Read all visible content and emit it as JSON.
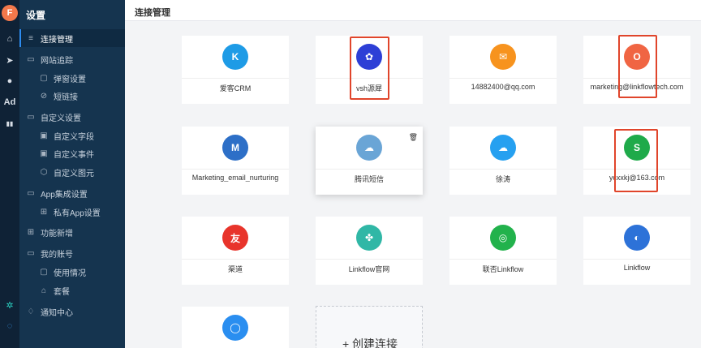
{
  "app": {
    "logo_letter": "F",
    "section_title": "设置"
  },
  "rail": {
    "items": [
      {
        "icon": "home-icon",
        "glyph": "⌂"
      },
      {
        "icon": "send-icon",
        "glyph": "➤"
      },
      {
        "icon": "user-icon",
        "glyph": "●"
      },
      {
        "icon": "ad-icon",
        "glyph": "Ad"
      },
      {
        "icon": "bar-chart-icon",
        "glyph": "▮▮"
      }
    ],
    "bottom": [
      {
        "icon": "gear-icon",
        "glyph": "✲"
      },
      {
        "icon": "chat-icon",
        "glyph": "◌"
      }
    ]
  },
  "sidebar": {
    "items": [
      {
        "label": "连接管理",
        "glyph": "≡",
        "level": 1,
        "active": true
      },
      {
        "label": "网站追踪",
        "glyph": "▭",
        "level": 1
      },
      {
        "label": "弹窗设置",
        "glyph": "▢",
        "level": 2
      },
      {
        "label": "短链接",
        "glyph": "⊘",
        "level": 2
      },
      {
        "label": "自定义设置",
        "glyph": "▭",
        "level": 1
      },
      {
        "label": "自定义字段",
        "glyph": "▣",
        "level": 2
      },
      {
        "label": "自定义事件",
        "glyph": "▣",
        "level": 2
      },
      {
        "label": "自定义图元",
        "glyph": "⬡",
        "level": 2
      },
      {
        "label": "App集成设置",
        "glyph": "▭",
        "level": 1
      },
      {
        "label": "私有App设置",
        "glyph": "⊞",
        "level": 2
      },
      {
        "label": "功能新增",
        "glyph": "⊞",
        "level": 1
      },
      {
        "label": "我的账号",
        "glyph": "▭",
        "level": 1
      },
      {
        "label": "使用情况",
        "glyph": "▢",
        "level": 2
      },
      {
        "label": "套餐",
        "glyph": "⌂",
        "level": 2
      },
      {
        "label": "通知中心",
        "glyph": "♢",
        "level": 1
      }
    ]
  },
  "header": {
    "title": "连接管理"
  },
  "cards": [
    {
      "label": "爱客CRM",
      "color": "#1e9be6",
      "glyph": "K"
    },
    {
      "label": "vsh源犀",
      "color": "#2d3fd6",
      "glyph": "✿"
    },
    {
      "label": "14882400@qq.com",
      "color": "#f7931e",
      "glyph": "✉"
    },
    {
      "label": "marketing@linkflowtech.com",
      "color": "#f06543",
      "glyph": "O"
    },
    {
      "label": "Marketing_email_nurturing",
      "color": "#2d6fc7",
      "glyph": "M"
    },
    {
      "label": "腾讯短信",
      "color": "#6aa5d6",
      "glyph": "☁"
    },
    {
      "label": "徐涛",
      "color": "#26a0f0",
      "glyph": "☁"
    },
    {
      "label": "ycxxkj@163.com",
      "color": "#1faa4a",
      "glyph": "S"
    },
    {
      "label": "渠道",
      "color": "#e8342b",
      "glyph": "友"
    },
    {
      "label": "Linkflow官网",
      "color": "#30b7a6",
      "glyph": "✤"
    },
    {
      "label": "联否Linkflow",
      "color": "#22b24c",
      "glyph": "◎"
    },
    {
      "label": "Linkflow",
      "color": "#2d72d8",
      "glyph": "◐"
    },
    {
      "label": "",
      "color": "#2a8ef0",
      "glyph": "◯"
    }
  ],
  "hovered_card": {
    "trash_glyph": "🗑"
  },
  "create": {
    "label": "+ 创建连接"
  },
  "highlight_color": "#e0452b"
}
